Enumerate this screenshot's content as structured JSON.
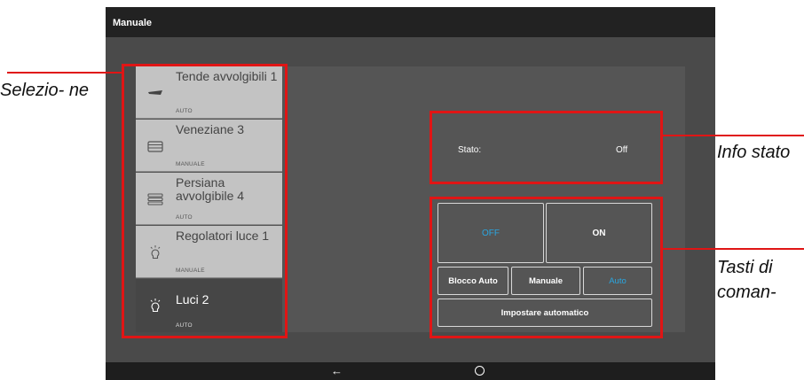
{
  "app": {
    "title": "Manuale"
  },
  "list": {
    "items": [
      {
        "label": "Tende avvolgibili 1",
        "status": "AUTO",
        "icon": "awning-icon"
      },
      {
        "label": "Veneziane 3",
        "status": "MANUALE",
        "icon": "venetian-blind-icon"
      },
      {
        "label": "Persiana avvolgibile 4",
        "status": "AUTO",
        "icon": "roller-shutter-icon"
      },
      {
        "label": "Regolatori luce 1",
        "status": "MANUALE",
        "icon": "dimmer-bulb-icon"
      },
      {
        "label": "Luci 2",
        "status": "AUTO",
        "icon": "light-bulb-icon",
        "selected": true
      }
    ]
  },
  "status": {
    "label": "Stato:",
    "value": "Off"
  },
  "controls": {
    "off": "OFF",
    "on": "ON",
    "blocco_auto": "Blocco Auto",
    "manuale": "Manuale",
    "auto": "Auto",
    "impostare": "Impostare automatico"
  },
  "navbar": {
    "back_icon": "back-arrow-icon",
    "home_icon": "home-circle-icon"
  },
  "annotations": {
    "selezione": "Selezio- ne",
    "info_stato": "Info stato",
    "tasti": "Tasti di coman-"
  },
  "colors": {
    "accent": "#2aa6e0",
    "annotation_red": "#e01515",
    "selected_item": "#464646",
    "list_item": "#c3c3c3"
  }
}
